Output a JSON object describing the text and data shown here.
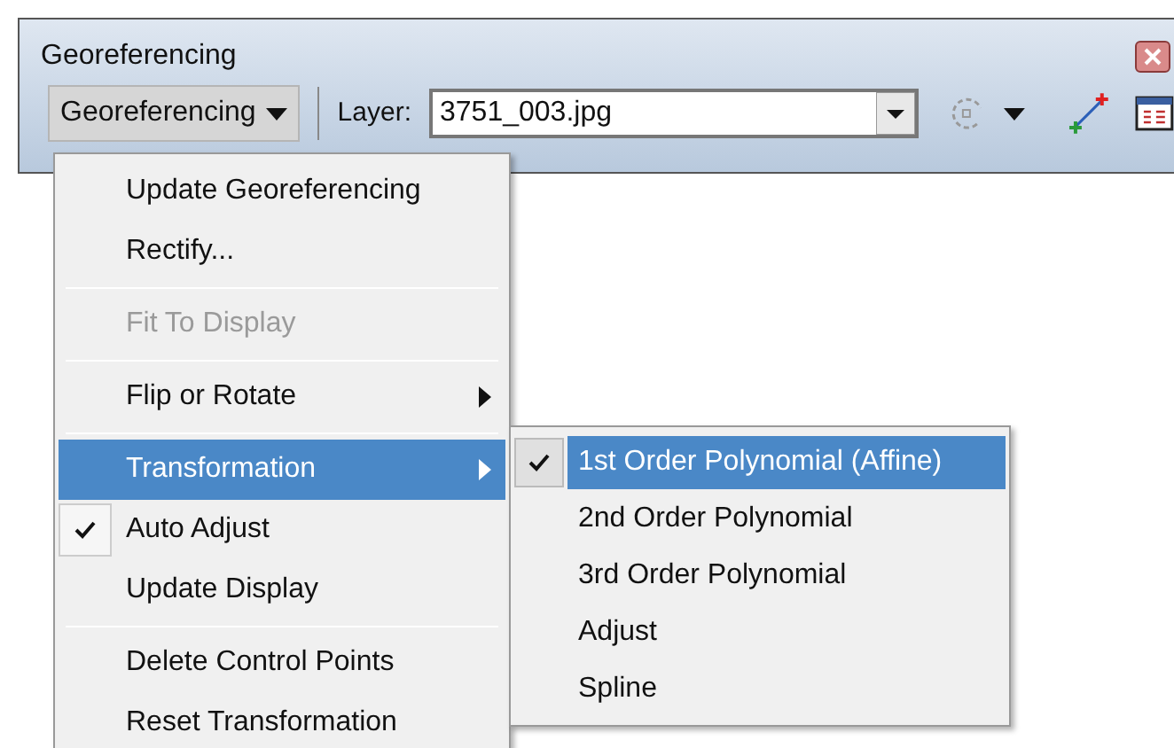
{
  "window": {
    "title": "Georeferencing"
  },
  "toolbar": {
    "menu_button": "Georeferencing",
    "layer_label": "Layer:",
    "layer_value": "3751_003.jpg"
  },
  "menu": {
    "groups": [
      [
        {
          "label": "Update Georeferencing",
          "disabled": false,
          "checked": false,
          "selected": false,
          "submenu": false
        },
        {
          "label": "Rectify...",
          "disabled": false,
          "checked": false,
          "selected": false,
          "submenu": false
        }
      ],
      [
        {
          "label": "Fit To Display",
          "disabled": true,
          "checked": false,
          "selected": false,
          "submenu": false
        }
      ],
      [
        {
          "label": "Flip or Rotate",
          "disabled": false,
          "checked": false,
          "selected": false,
          "submenu": true
        }
      ],
      [
        {
          "label": "Transformation",
          "disabled": false,
          "checked": false,
          "selected": true,
          "submenu": true
        },
        {
          "label": "Auto Adjust",
          "disabled": false,
          "checked": true,
          "selected": false,
          "submenu": false
        },
        {
          "label": "Update Display",
          "disabled": false,
          "checked": false,
          "selected": false,
          "submenu": false
        }
      ],
      [
        {
          "label": "Delete Control Points",
          "disabled": false,
          "checked": false,
          "selected": false,
          "submenu": false
        },
        {
          "label": "Reset Transformation",
          "disabled": false,
          "checked": false,
          "selected": false,
          "submenu": false
        }
      ]
    ]
  },
  "submenu": {
    "items": [
      {
        "label": "1st Order Polynomial (Affine)",
        "checked": true,
        "selected": true
      },
      {
        "label": "2nd Order Polynomial",
        "checked": false,
        "selected": false
      },
      {
        "label": "3rd Order Polynomial",
        "checked": false,
        "selected": false
      },
      {
        "label": "Adjust",
        "checked": false,
        "selected": false
      },
      {
        "label": "Spline",
        "checked": false,
        "selected": false
      }
    ]
  }
}
